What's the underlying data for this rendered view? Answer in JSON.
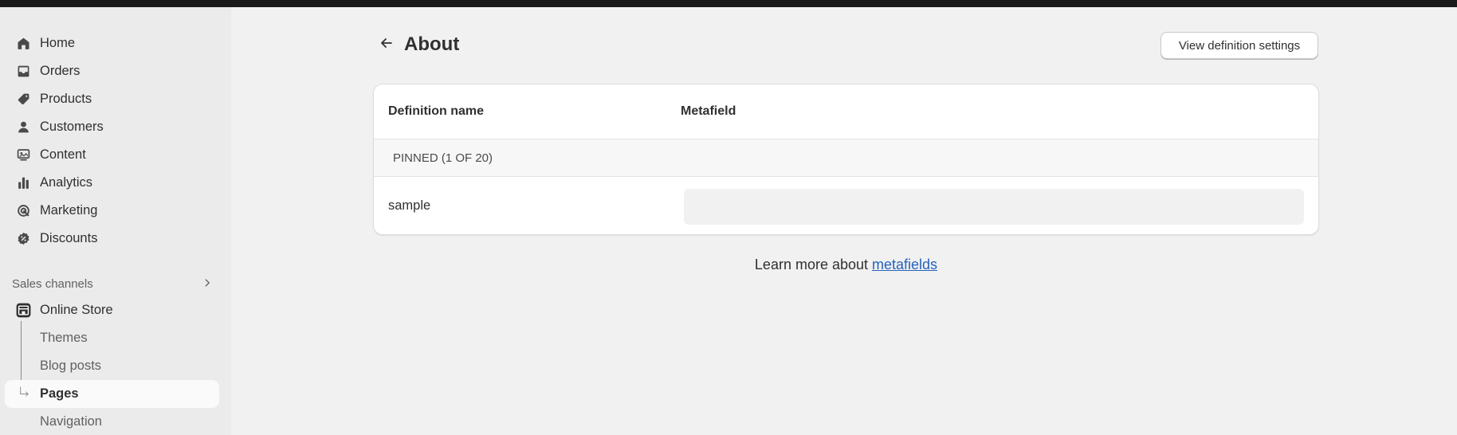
{
  "sidebar": {
    "items": [
      {
        "label": "Home",
        "icon": "home-icon"
      },
      {
        "label": "Orders",
        "icon": "inbox-icon"
      },
      {
        "label": "Products",
        "icon": "tag-icon"
      },
      {
        "label": "Customers",
        "icon": "person-icon"
      },
      {
        "label": "Content",
        "icon": "content-icon"
      },
      {
        "label": "Analytics",
        "icon": "bar-chart-icon"
      },
      {
        "label": "Marketing",
        "icon": "target-icon"
      },
      {
        "label": "Discounts",
        "icon": "discount-icon"
      }
    ],
    "sales_channels_label": "Sales channels",
    "online_store_label": "Online Store",
    "online_store_subitems": [
      {
        "label": "Themes"
      },
      {
        "label": "Blog posts"
      },
      {
        "label": "Pages",
        "active": true
      },
      {
        "label": "Navigation"
      }
    ]
  },
  "header": {
    "title": "About",
    "view_definition_settings_label": "View definition settings"
  },
  "table": {
    "columns": [
      "Definition name",
      "Metafield"
    ],
    "pinned_label": "PINNED (1 OF 20)",
    "rows": [
      {
        "name": "sample",
        "value": ""
      }
    ]
  },
  "footer": {
    "learn_more_text": "Learn more about ",
    "learn_more_link": "metafields"
  },
  "colors": {
    "topbar": "#1a1a1a",
    "sidebar_bg": "#ebebeb",
    "page_bg": "#f1f1f1",
    "link": "#2463bc"
  }
}
